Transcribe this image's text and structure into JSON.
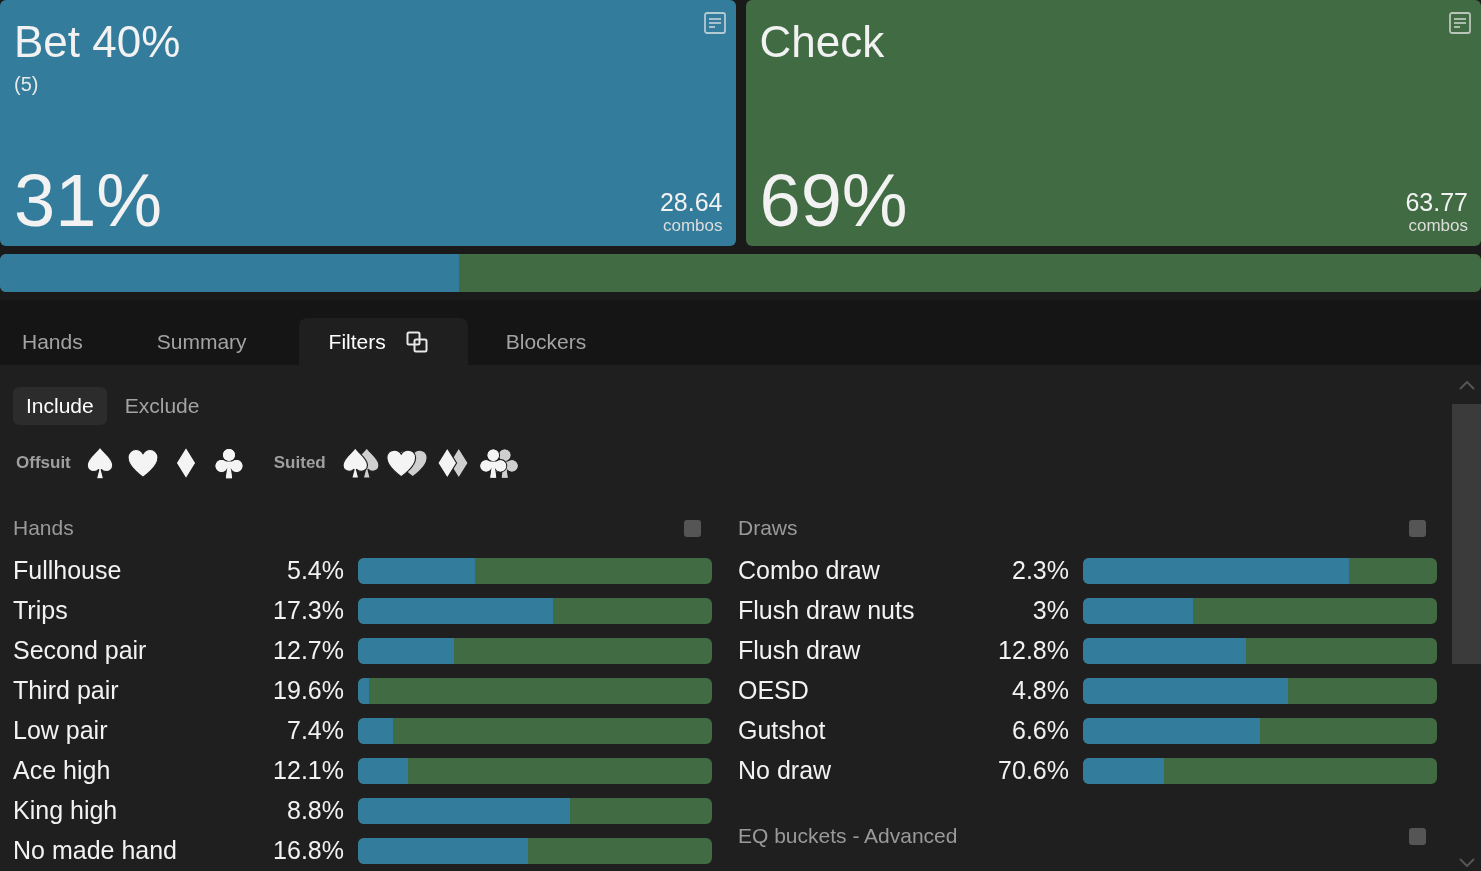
{
  "actions": [
    {
      "title": "Bet 40%",
      "subtitle": "(5)",
      "percent": "31%",
      "combos": "28.64",
      "combos_label": "combos",
      "color": "#337c9c"
    },
    {
      "title": "Check",
      "percent": "69%",
      "combos": "63.77",
      "combos_label": "combos",
      "color": "#416b42"
    }
  ],
  "strategy_bar": {
    "level": 0.31
  },
  "tabs": [
    {
      "label": "Hands",
      "selected": false
    },
    {
      "label": "Summary",
      "selected": false
    },
    {
      "label": "Filters",
      "selected": true
    },
    {
      "label": "Blockers",
      "selected": false
    }
  ],
  "filter_mode": [
    {
      "label": "Include",
      "selected": true
    },
    {
      "label": "Exclude",
      "selected": false
    }
  ],
  "suit_filters": {
    "offsuit_label": "Offsuit",
    "suited_label": "Suited"
  },
  "columns": [
    {
      "sections": [
        {
          "title": "Hands",
          "checked": false,
          "rows": [
            {
              "label": "Fullhouse",
              "percent": "5.4%",
              "level": 0.33
            },
            {
              "label": "Trips",
              "percent": "17.3%",
              "level": 0.55
            },
            {
              "label": "Second pair",
              "percent": "12.7%",
              "level": 0.27
            },
            {
              "label": "Third pair",
              "percent": "19.6%",
              "level": 0.03
            },
            {
              "label": "Low pair",
              "percent": "7.4%",
              "level": 0.1
            },
            {
              "label": "Ace high",
              "percent": "12.1%",
              "level": 0.14
            },
            {
              "label": "King high",
              "percent": "8.8%",
              "level": 0.6
            },
            {
              "label": "No made hand",
              "percent": "16.8%",
              "level": 0.48
            }
          ]
        }
      ]
    },
    {
      "sections": [
        {
          "title": "Draws",
          "checked": false,
          "rows": [
            {
              "label": "Combo draw",
              "percent": "2.3%",
              "level": 0.75
            },
            {
              "label": "Flush draw nuts",
              "percent": "3%",
              "level": 0.31
            },
            {
              "label": "Flush draw",
              "percent": "12.8%",
              "level": 0.46
            },
            {
              "label": "OESD",
              "percent": "4.8%",
              "level": 0.58
            },
            {
              "label": "Gutshot",
              "percent": "6.6%",
              "level": 0.5
            },
            {
              "label": "No draw",
              "percent": "70.6%",
              "level": 0.23
            }
          ]
        },
        {
          "title": "EQ buckets - Advanced",
          "checked": false
        }
      ]
    }
  ]
}
